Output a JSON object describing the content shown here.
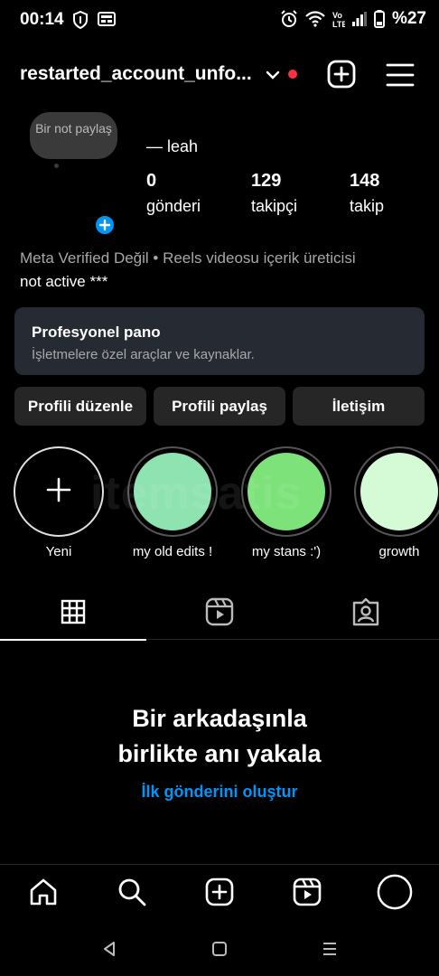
{
  "status_bar": {
    "time": "00:14",
    "battery": "%27",
    "icons": [
      "shield-icon",
      "news-icon",
      "alarm-icon",
      "wifi-icon",
      "volte-icon",
      "signal-icon",
      "battery-icon"
    ]
  },
  "header": {
    "username": "restarted_account_unfo...",
    "has_notification_dot": true,
    "icons": [
      "chevron-down-icon",
      "add-icon",
      "menu-icon"
    ]
  },
  "profile": {
    "note": "Bir not paylaş",
    "display_name": "— leah",
    "stats": [
      {
        "value": "0",
        "label": "gönderi"
      },
      {
        "value": "129",
        "label": "takipçi"
      },
      {
        "value": "148",
        "label": "takip"
      }
    ],
    "bio_line1": "Meta Verified Değil • Reels videosu içerik üreticisi",
    "bio_line2": "not active ***"
  },
  "pro_dashboard": {
    "title": "Profesyonel pano",
    "subtitle": "İşletmelere özel araçlar ve kaynaklar."
  },
  "buttons": {
    "edit_profile": "Profili düzenle",
    "share_profile": "Profili paylaş",
    "contact": "İletişim"
  },
  "highlights": [
    {
      "label": "Yeni",
      "type": "new"
    },
    {
      "label": "my old edits !",
      "color": "#8fe3b0"
    },
    {
      "label": "my stans :')",
      "color": "#7de27a"
    },
    {
      "label": "growth",
      "color": "#d4fbd6"
    }
  ],
  "watermark": "itemsatis",
  "tabs": [
    {
      "name": "grid",
      "icon": "grid-icon",
      "active": true
    },
    {
      "name": "reels",
      "icon": "reels-icon",
      "active": false
    },
    {
      "name": "tagged",
      "icon": "tagged-icon",
      "active": false
    }
  ],
  "empty_state": {
    "title_line1": "Bir arkadaşınla",
    "title_line2": "birlikte anı yakala",
    "link": "İlk gönderini oluştur"
  },
  "bottom_nav": [
    "home-icon",
    "search-icon",
    "create-icon",
    "reels-icon",
    "profile-icon"
  ],
  "colors": {
    "accent": "#0095f6",
    "notification": "#ff3040",
    "card_bg": "#262a33",
    "button_bg": "#262626"
  }
}
